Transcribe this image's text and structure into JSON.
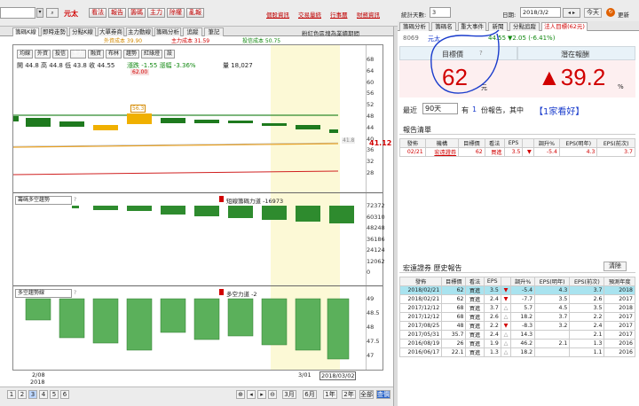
{
  "toolbar": {
    "stock_name": "元太",
    "buttons": [
      "看法",
      "報告",
      "籌碼",
      "主力",
      "除權",
      "亂報"
    ],
    "links": [
      "個股資訊",
      "交易量統",
      "行事曆",
      "財務資訊"
    ]
  },
  "right_toolbar": {
    "stat_days_label": "統計天數:",
    "stat_days_value": "3",
    "date_label": "日期:",
    "date_value": "2018/3/2",
    "today_label": "今天",
    "update_label": "更新"
  },
  "left_tabs": [
    "籌碼K線",
    "即時走勢",
    "分點K線",
    "大單券商",
    "主力動線",
    "籌碼分析",
    "追蹤",
    "筆記"
  ],
  "left_subheader": "粉紅色區塊為業績期間",
  "right_tabs_row1": [
    "籌碼分析",
    "籌碼名",
    "重大事件",
    "新聞",
    "分點追蹤",
    "法人目標(62元)"
  ],
  "right_stock": {
    "code": "8069",
    "name": "元太",
    "price": "44.55",
    "change": "▼2.05 (-6.41%)",
    "target_label": "目標價",
    "target_value": "62",
    "target_unit": "元",
    "potential_label": "潛在報酬",
    "potential_value": "▲39.2",
    "potential_unit": "%"
  },
  "recent": {
    "prefix": "最近",
    "period": "90天",
    "mid": "有",
    "count": "1",
    "suffix": "份報告，其中",
    "highlight": "【1家看好】"
  },
  "report_list": {
    "title": "報告清單",
    "headers": [
      "發佈",
      "機構",
      "目標價",
      "看法",
      "EPS",
      "",
      "調升%",
      "EPS(明年)",
      "EPS(前次)"
    ],
    "rows": [
      [
        "02/21",
        "宏遠證券",
        "62",
        "買進",
        "3.5",
        "▼",
        "-5.4",
        "4.3",
        "3.7"
      ]
    ]
  },
  "history": {
    "title": "宏遠證券 歷史報告",
    "clear_label": "清除",
    "headers": [
      "發佈",
      "目標價",
      "看法",
      "EPS",
      "",
      "調升%",
      "EPS(明年)",
      "EPS(前次)",
      "預測年度"
    ],
    "rows": [
      [
        "2018/02/21",
        "62",
        "買進",
        "3.5",
        "▼",
        "-5.4",
        "4.3",
        "3.7",
        "2018"
      ],
      [
        "2018/02/21",
        "62",
        "買進",
        "2.4",
        "▼",
        "-7.7",
        "3.5",
        "2.6",
        "2017"
      ],
      [
        "2017/12/12",
        "68",
        "買進",
        "3.7",
        "△",
        "5.7",
        "4.5",
        "3.5",
        "2018"
      ],
      [
        "2017/12/12",
        "68",
        "買進",
        "2.6",
        "△",
        "18.2",
        "3.7",
        "2.2",
        "2017"
      ],
      [
        "2017/08/25",
        "48",
        "買進",
        "2.2",
        "▼",
        "-8.3",
        "3.2",
        "2.4",
        "2017"
      ],
      [
        "2017/05/31",
        "35.7",
        "買進",
        "2.4",
        "△",
        "14.3",
        "",
        "2.1",
        "2017"
      ],
      [
        "2016/08/19",
        "26",
        "買進",
        "1.9",
        "△",
        "46.2",
        "2.1",
        "1.3",
        "2016"
      ],
      [
        "2016/06/17",
        "22.1",
        "買進",
        "1.3",
        "△",
        "18.2",
        "",
        "1.1",
        "2016"
      ]
    ]
  },
  "price_chart": {
    "legend": [
      "外資成本 39.90",
      "主力成本 31.59",
      "投信成本 50.75"
    ],
    "indicator_tabs": [
      "均線",
      "外資",
      "投信",
      "主力",
      "融資",
      "布林",
      "趨勢",
      "紅綠燈",
      "設"
    ],
    "ohlc": "開 44.8  高 44.8  低 43.8  收 44.55",
    "change_text": "漲跌 -1.55  漲幅 -3.36%",
    "volume_text": "量 18,027",
    "target_tag": "62.00",
    "mid_tag": "56.3",
    "close_tag": "41.8",
    "right_value": "41.12",
    "y_ticks": [
      "68",
      "64",
      "60",
      "56",
      "52",
      "48",
      "44",
      "40",
      "36",
      "32",
      "28"
    ]
  },
  "chip_panel": {
    "select_label": "籌碼多空趨勢",
    "indicator_text": "短線籌碼力道 -16973",
    "y_ticks": [
      "72372",
      "60310",
      "48248",
      "36186",
      "24124",
      "12062",
      "0"
    ]
  },
  "trend_panel": {
    "select_label": "多空趨勢線",
    "indicator_text": "多空力道 -2",
    "y_ticks": [
      "49",
      "48.5",
      "48",
      "47.5",
      "47"
    ]
  },
  "x_axis": {
    "left_label": "2/08",
    "left_year": "2018",
    "mid_label": "3/01",
    "end_label": "2018/03/02"
  },
  "bottom_bar": {
    "pages": [
      "1",
      "2",
      "3",
      "4",
      "5",
      "6"
    ],
    "periods": [
      "3月",
      "6月",
      "1年",
      "2年",
      "全部",
      "查價"
    ]
  }
}
